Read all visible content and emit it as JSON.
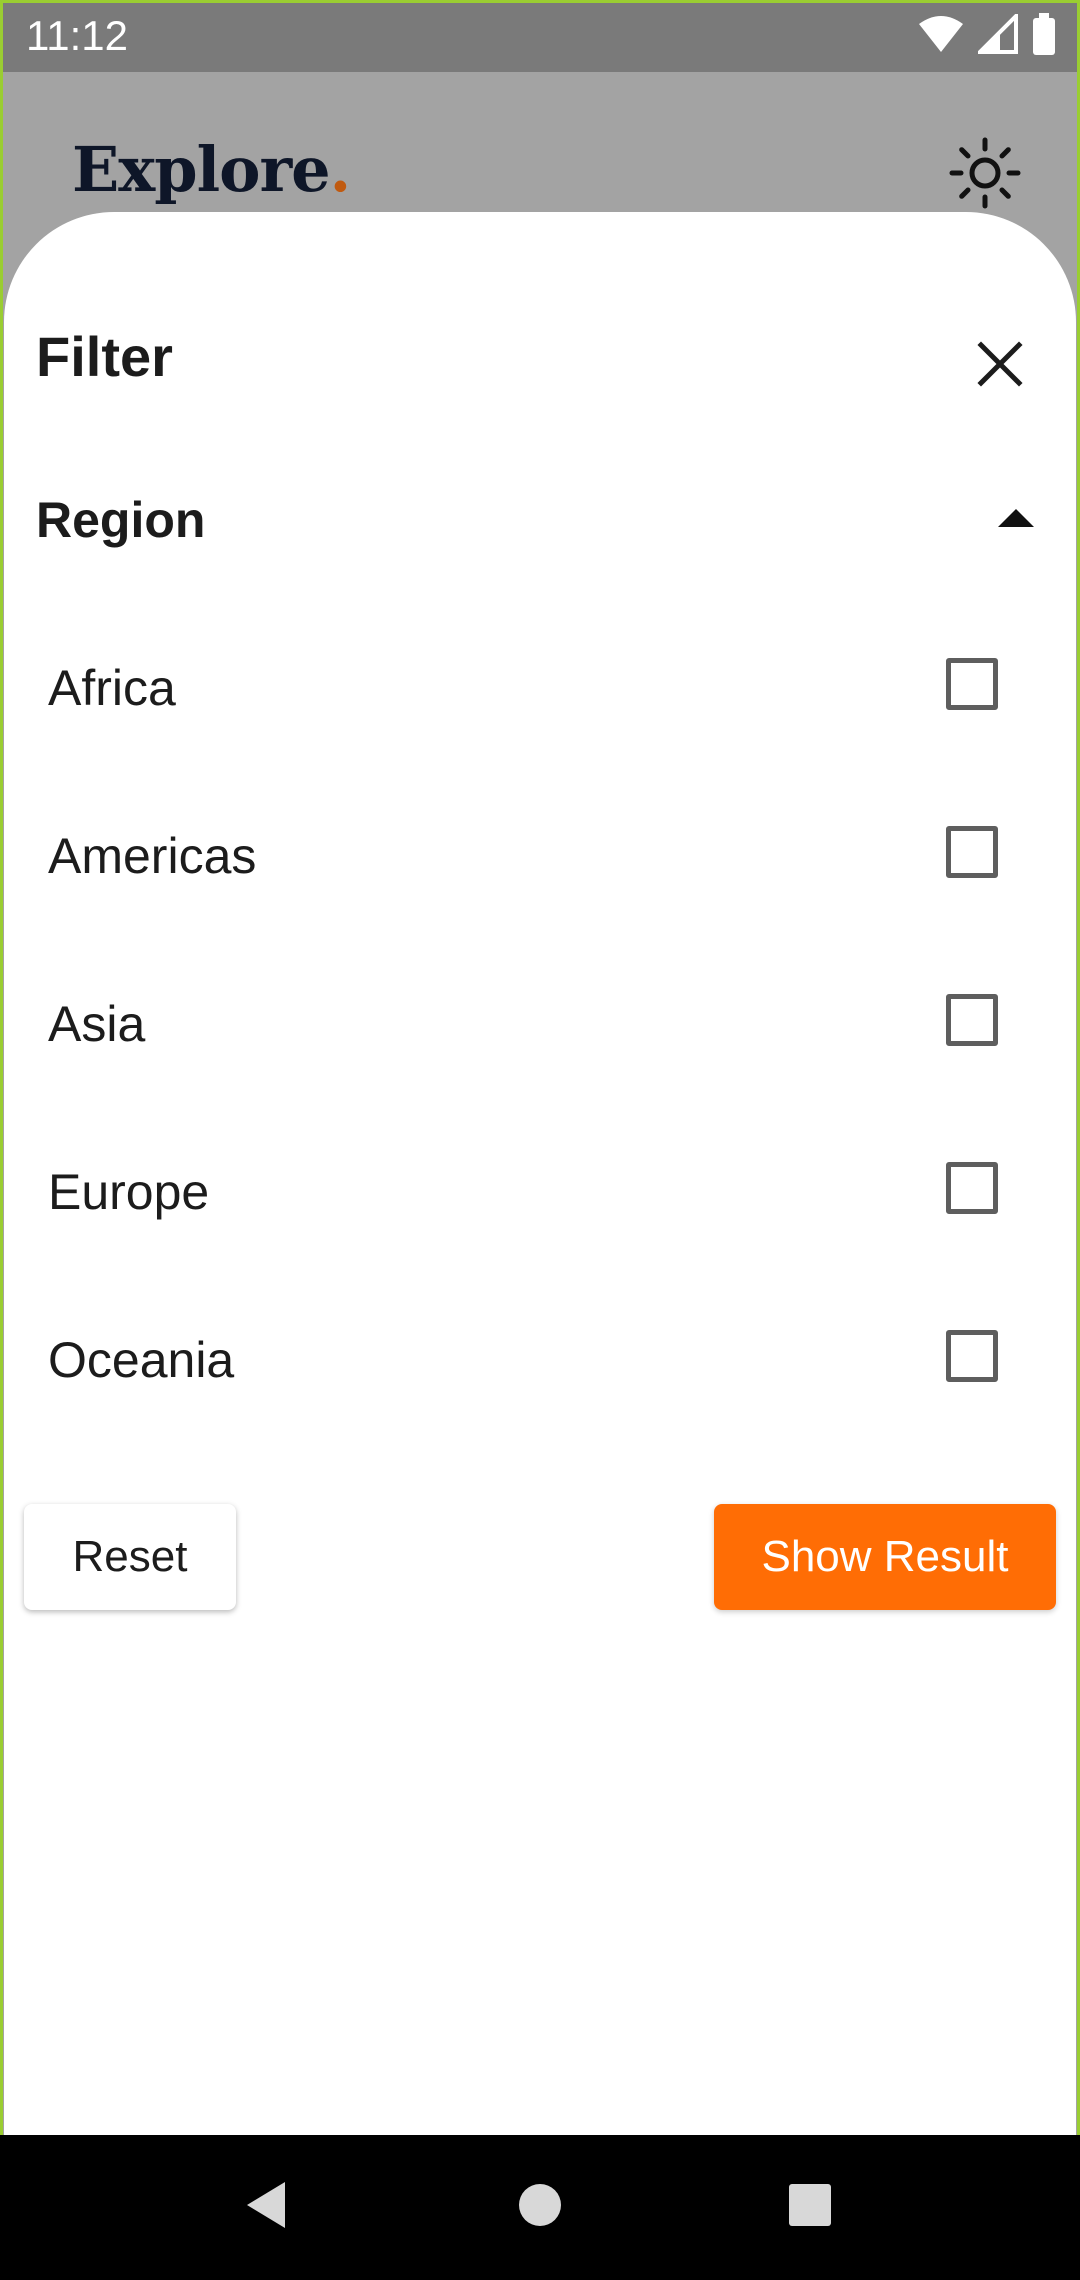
{
  "status_bar": {
    "time": "11:12",
    "icons": [
      "wifi-icon",
      "cell-signal-icon",
      "battery-icon"
    ]
  },
  "app": {
    "logo_text": "Explore",
    "logo_dot": ".",
    "theme_icon": "sun-icon"
  },
  "filter_sheet": {
    "title": "Filter",
    "close_icon": "close-icon",
    "section": {
      "title": "Region",
      "toggle_icon": "caret-up-icon",
      "items": [
        {
          "label": "Africa",
          "checked": false
        },
        {
          "label": "Americas",
          "checked": false
        },
        {
          "label": "Asia",
          "checked": false
        },
        {
          "label": "Europe",
          "checked": false
        },
        {
          "label": "Oceania",
          "checked": false
        }
      ]
    },
    "reset_label": "Reset",
    "show_result_label": "Show Result"
  },
  "nav_bar": {
    "icons": [
      "back-icon",
      "home-icon",
      "recents-icon"
    ]
  },
  "colors": {
    "accent": "#ff6d05",
    "logo_dot": "#c05a10",
    "scrim": "#a3a3a3",
    "frame": "#9acd32"
  }
}
